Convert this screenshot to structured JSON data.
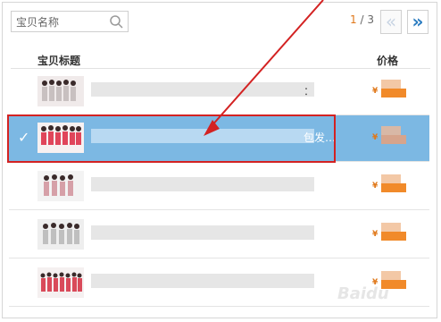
{
  "search": {
    "placeholder": "宝贝名称",
    "icon": "search-icon"
  },
  "pager": {
    "current": "1",
    "separator": " / ",
    "total": "3",
    "prev_label": "«",
    "next_label": "»"
  },
  "table": {
    "headers": {
      "title": "宝贝标题",
      "price": "价格"
    },
    "rows": [
      {
        "suffix": "：",
        "selected": false
      },
      {
        "suffix": "包发…",
        "selected": true
      },
      {
        "suffix": "",
        "selected": false
      },
      {
        "suffix": "",
        "selected": false
      },
      {
        "suffix": "",
        "selected": false
      }
    ],
    "currency_symbol": "¥"
  },
  "watermark": "Baidu"
}
